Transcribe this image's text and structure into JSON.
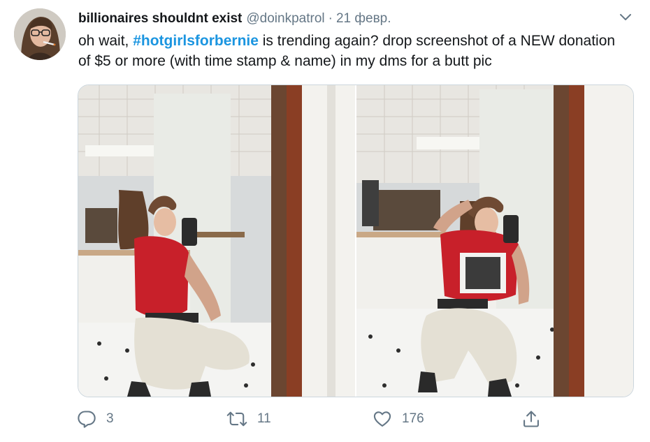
{
  "tweet": {
    "author": {
      "display_name": "billionaires shouldnt exist",
      "handle": "@doinkpatrol"
    },
    "separator": "·",
    "date": "21 февр.",
    "text_before": "oh wait, ",
    "hashtag": "#hotgirlsforbernie",
    "text_after": " is trending again? drop screenshot of a NEW donation of $5 or more (with time stamp & name) in my dms for a butt pic",
    "media": [
      {
        "kind": "photo"
      },
      {
        "kind": "photo"
      }
    ],
    "actions": {
      "reply_count": "3",
      "retweet_count": "11",
      "like_count": "176"
    }
  },
  "icons": {
    "caret": "chevron-down-icon",
    "reply": "reply-icon",
    "retweet": "retweet-icon",
    "like": "heart-icon",
    "share": "share-icon"
  },
  "colors": {
    "hashtag": "#1b95e0",
    "secondary_text": "#657786",
    "primary_text": "#14171a"
  }
}
